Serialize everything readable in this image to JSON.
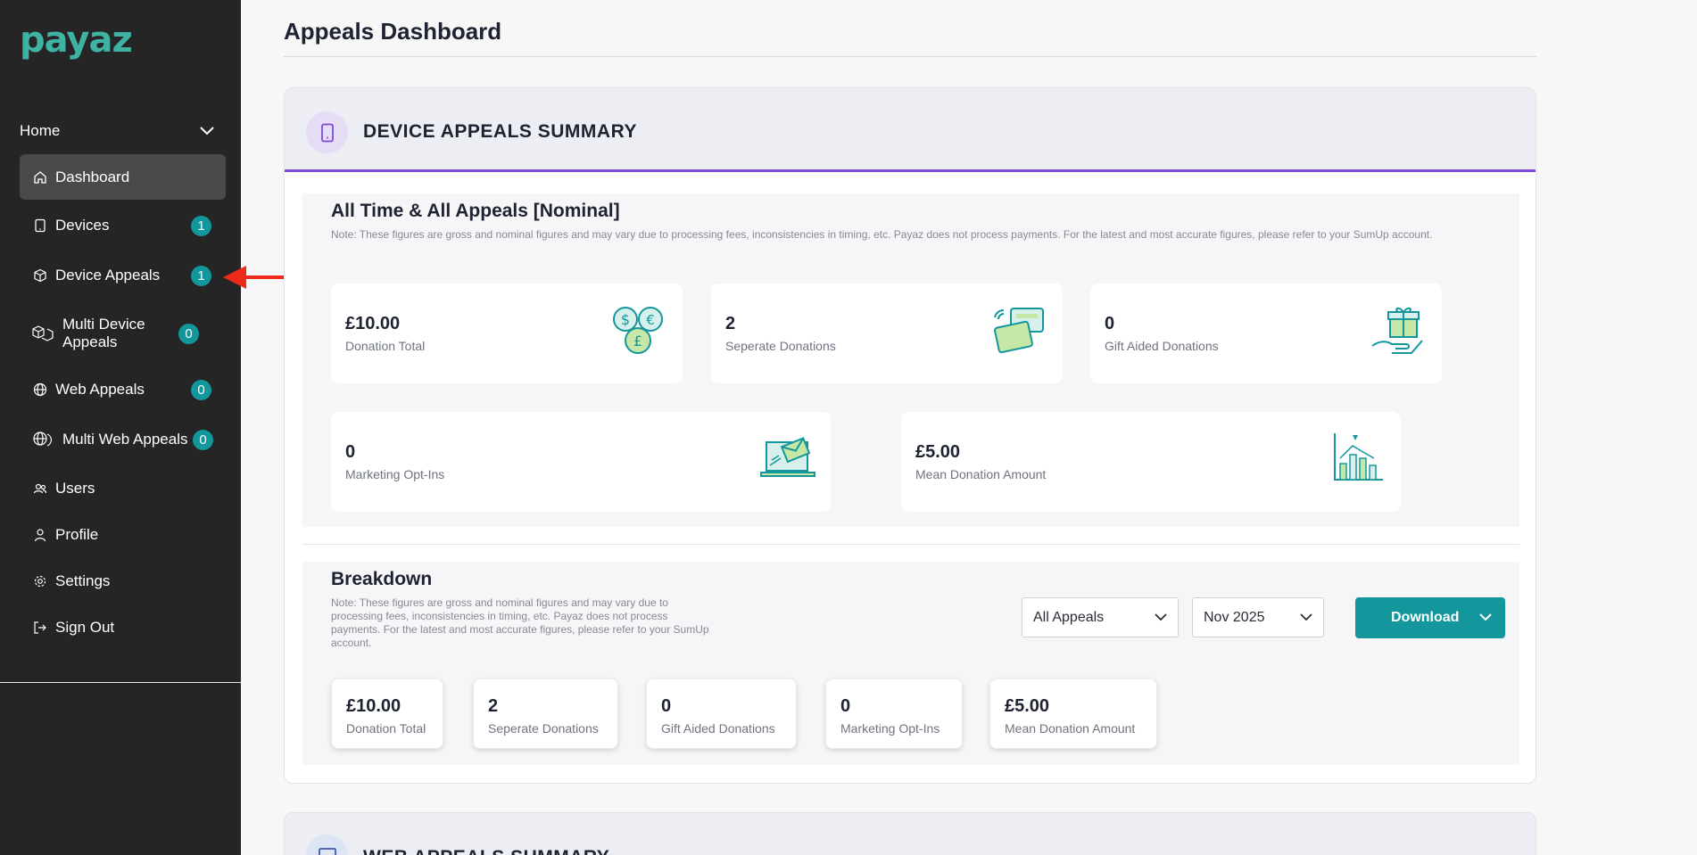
{
  "brand": {
    "logo_text": "payaz"
  },
  "sidebar": {
    "home_label": "Home",
    "items": [
      {
        "label": "Dashboard",
        "icon": "home-icon",
        "badge": null
      },
      {
        "label": "Devices",
        "icon": "tablet-icon",
        "badge": "1"
      },
      {
        "label": "Device Appeals",
        "icon": "box-icon",
        "badge": "1"
      },
      {
        "label": "Multi Device Appeals",
        "icon": "boxes-icon",
        "badge": "0"
      },
      {
        "label": "Web Appeals",
        "icon": "globe-icon",
        "badge": "0"
      },
      {
        "label": "Multi Web Appeals",
        "icon": "globes-icon",
        "badge": "0"
      },
      {
        "label": "Users",
        "icon": "users-icon",
        "badge": null
      },
      {
        "label": "Profile",
        "icon": "user-icon",
        "badge": null
      },
      {
        "label": "Settings",
        "icon": "gear-icon",
        "badge": null
      },
      {
        "label": "Sign Out",
        "icon": "sign-out-icon",
        "badge": null
      }
    ]
  },
  "page": {
    "title": "Appeals Dashboard"
  },
  "device_summary": {
    "title": "DEVICE APPEALS SUMMARY",
    "all_time": {
      "title": "All Time & All Appeals [Nominal]",
      "note": "Note: These figures are gross and nominal figures and may vary due to processing fees, inconsistencies in timing, etc. Payaz does not process payments. For the latest and most accurate figures, please refer to your SumUp account.",
      "stats": [
        {
          "value": "£10.00",
          "label": "Donation Total"
        },
        {
          "value": "2",
          "label": "Seperate Donations"
        },
        {
          "value": "0",
          "label": "Gift Aided Donations"
        },
        {
          "value": "0",
          "label": "Marketing Opt-Ins"
        },
        {
          "value": "£5.00",
          "label": "Mean Donation Amount"
        }
      ]
    },
    "breakdown": {
      "title": "Breakdown",
      "note": "Note: These figures are gross and nominal figures and may vary due to processing fees, inconsistencies in timing, etc. Payaz does not process payments. For the latest and most accurate figures, please refer to your SumUp account.",
      "appeal_filter": "All Appeals",
      "month_filter": "Nov 2025",
      "download_label": "Download",
      "stats": [
        {
          "value": "£10.00",
          "label": "Donation Total"
        },
        {
          "value": "2",
          "label": "Seperate Donations"
        },
        {
          "value": "0",
          "label": "Gift Aided Donations"
        },
        {
          "value": "0",
          "label": "Marketing Opt-Ins"
        },
        {
          "value": "£5.00",
          "label": "Mean Donation Amount"
        }
      ]
    }
  },
  "web_summary": {
    "title": "WEB APPEALS SUMMARY"
  },
  "colors": {
    "sidebar_bg": "#252525",
    "accent_teal": "#13979d",
    "accent_purple": "#7e49d6",
    "annotation_red": "#ee2a1b"
  }
}
